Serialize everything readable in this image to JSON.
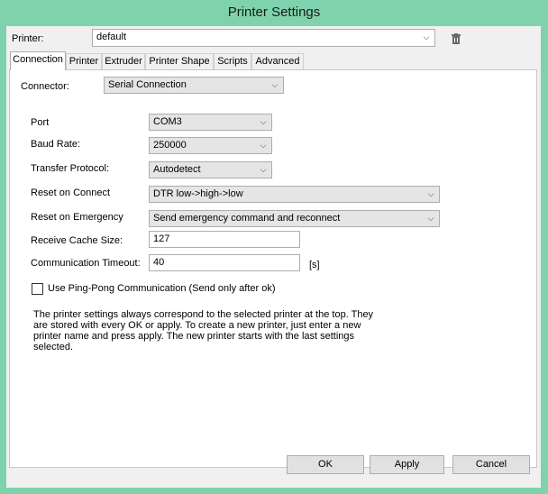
{
  "window": {
    "title": "Printer Settings"
  },
  "printer": {
    "label": "Printer:",
    "value": "default"
  },
  "tabs": [
    {
      "label": "Connection"
    },
    {
      "label": "Printer"
    },
    {
      "label": "Extruder"
    },
    {
      "label": "Printer Shape"
    },
    {
      "label": "Scripts"
    },
    {
      "label": "Advanced"
    }
  ],
  "connection": {
    "connector_label": "Connector:",
    "connector_value": "Serial Connection",
    "port_label": "Port",
    "port_value": "COM3",
    "baud_label": "Baud Rate:",
    "baud_value": "250000",
    "protocol_label": "Transfer Protocol:",
    "protocol_value": "Autodetect",
    "reset_connect_label": "Reset on Connect",
    "reset_connect_value": "DTR low->high->low",
    "reset_emergency_label": "Reset on Emergency",
    "reset_emergency_value": "Send emergency command and reconnect",
    "cache_label": "Receive Cache Size:",
    "cache_value": "127",
    "timeout_label": "Communication Timeout:",
    "timeout_value": "40",
    "timeout_unit": "[s]",
    "pingpong_label": "Use Ping-Pong Communication (Send only after ok)",
    "pingpong_checked": false,
    "info_text": "The printer settings always correspond to the selected printer at the top. They are stored with every OK or apply. To create a new printer, just enter a new printer name and press apply. The new printer starts with the last settings selected."
  },
  "buttons": {
    "ok": "OK",
    "apply": "Apply",
    "cancel": "Cancel"
  }
}
